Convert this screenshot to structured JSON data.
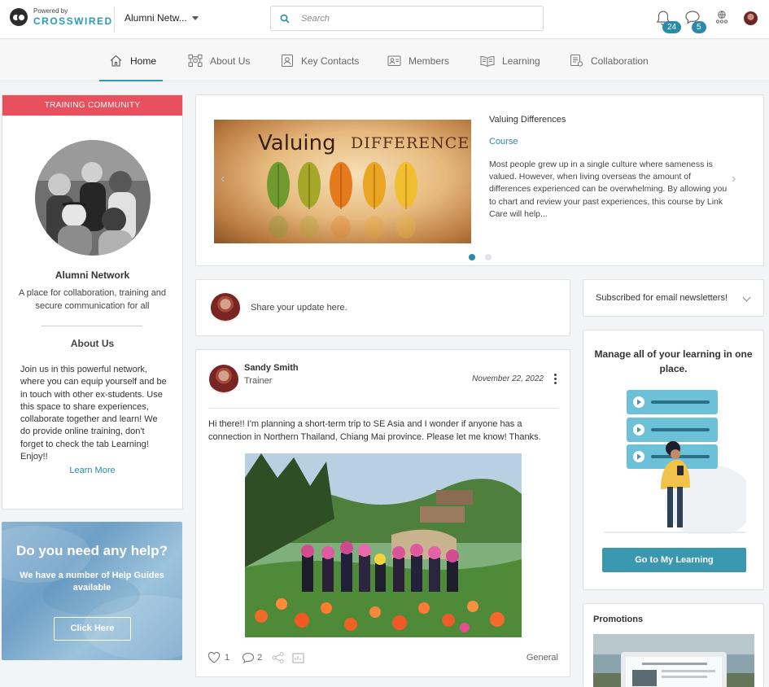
{
  "brand": {
    "powered_by": "Powered by",
    "name": "CROSSWIRED"
  },
  "header": {
    "network_name": "Alumni Netw...",
    "search_placeholder": "Search",
    "notifications_count": "24",
    "messages_count": "5"
  },
  "nav": {
    "items": [
      {
        "label": "Home",
        "icon": "home-icon",
        "active": true
      },
      {
        "label": "About Us",
        "icon": "about-icon"
      },
      {
        "label": "Key Contacts",
        "icon": "contacts-icon"
      },
      {
        "label": "Members",
        "icon": "members-icon"
      },
      {
        "label": "Learning",
        "icon": "learning-icon"
      },
      {
        "label": "Collaboration",
        "icon": "collaboration-icon"
      }
    ]
  },
  "community": {
    "header": "TRAINING COMMUNITY",
    "title": "Alumni Network",
    "description": "A place for collaboration, training and secure communication for all",
    "about_heading": "About Us",
    "about_text": "Join us in this powerful network, where you can equip yourself and be in touch with other ex-students. Use this space to share experiences, collaborate together and learn! We do provide online training, don't forget to check the tab Learning! Enjoy!!",
    "learn_more": "Learn More"
  },
  "help": {
    "title": "Do you need any help?",
    "subtitle": "We have a number of Help Guides available",
    "button": "Click Here"
  },
  "carousel": {
    "image_title_1": "Valuing",
    "image_title_2": "DIFFERENCES",
    "title": "Valuing Differences",
    "type": "Course",
    "description": "Most people grew up in a single culture where sameness is valued. However, when living overseas the amount of differences experienced can be overwhelming. By allowing you to chart and review your past experiences, this course by Link Care will help...",
    "active_slide": 1,
    "slide_count": 2
  },
  "share": {
    "placeholder": "Share your update here."
  },
  "newsletter": {
    "label": "Subscribed for email newsletters!"
  },
  "post": {
    "author": "Sandy Smith",
    "role": "Trainer",
    "date": "November 22, 2022",
    "text": "Hi there!! I'm planning a short-term trip to SE Asia and I wonder if anyone has a connection in Northern Thailand, Chiang Mai province. Please let me know! Thanks.",
    "likes": "1",
    "comments": "2",
    "tag": "General"
  },
  "learning": {
    "title": "Manage all of your learning in one place.",
    "button": "Go to My Learning"
  },
  "promotions": {
    "title": "Promotions"
  },
  "colors": {
    "accent": "#2a9bb8",
    "community_header": "#e9505e",
    "button": "#3a98b0"
  }
}
